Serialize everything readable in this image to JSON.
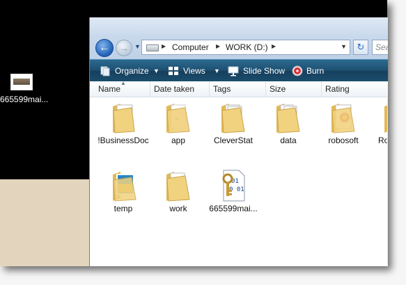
{
  "desktop": {
    "icon_label": "665599mai..."
  },
  "window": {
    "breadcrumb": [
      "Computer",
      "WORK (D:)"
    ],
    "search_placeholder": "Search"
  },
  "toolbar": {
    "organize": "Organize",
    "views": "Views",
    "slideshow": "Slide Show",
    "burn": "Burn"
  },
  "columns": [
    "Name",
    "Date taken",
    "Tags",
    "Size",
    "Rating"
  ],
  "items": [
    {
      "label": "!BusinessDoc",
      "icon": "folder-documents-icon"
    },
    {
      "label": "app",
      "icon": "folder-icon"
    },
    {
      "label": "CleverStat",
      "icon": "folder-documents-icon"
    },
    {
      "label": "data",
      "icon": "folder-icon"
    },
    {
      "label": "robosoft",
      "icon": "folder-icon"
    },
    {
      "label": "Ro",
      "icon": "folder-icon"
    },
    {
      "label": "temp",
      "icon": "folder-pictures-icon"
    },
    {
      "label": "work",
      "icon": "folder-icon"
    },
    {
      "label": "665599mai...",
      "icon": "binary-key-file-icon"
    }
  ],
  "colors": {
    "toolbar": "#1d4f70",
    "address_bar": "#c9d9ec",
    "folder": "#f1d27e",
    "desktop_beige": "#e3d5bd"
  }
}
